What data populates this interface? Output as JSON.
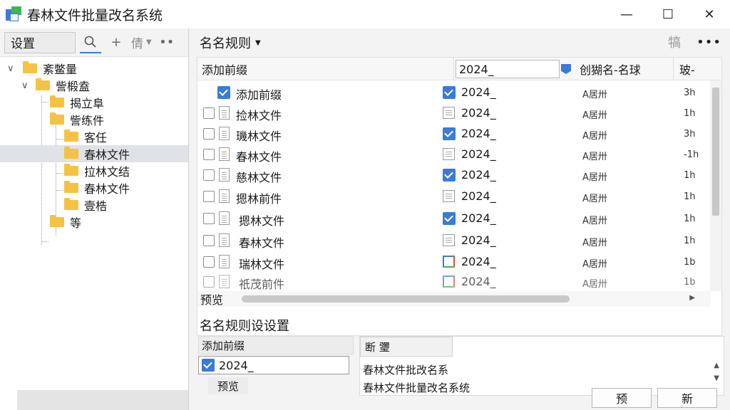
{
  "window": {
    "title": "春林文件批量改名系统",
    "controls": {
      "minimize": "—",
      "maximize": "☐",
      "close": "✕"
    }
  },
  "left_toolbar": {
    "settings_label": "设置",
    "search_icon": "search-icon",
    "add_symbol": "+",
    "combo_label": "倩",
    "more_symbol": "••"
  },
  "tree": {
    "items": [
      {
        "label": "紊鳖量"
      },
      {
        "label": "訾椴盍"
      },
      {
        "label": "揭立阜"
      },
      {
        "label": "訾练件"
      },
      {
        "label": "客任"
      },
      {
        "label": "春林文件"
      },
      {
        "label": "拉林文结"
      },
      {
        "label": "春林文件"
      },
      {
        "label": "壹梏"
      },
      {
        "label": "等"
      }
    ]
  },
  "right_header": {
    "title": "名名规则",
    "icon_label": "犒",
    "more_symbol": "•••"
  },
  "grid": {
    "columns": [
      "添加前缀",
      "创猢名-名球",
      "玻-"
    ],
    "prefix_value": "2024_",
    "rows": [
      {
        "name": "添加前缀",
        "value": "2024_",
        "date": "A居卅",
        "size": "3h"
      },
      {
        "name": "捡林文件",
        "value": "2024_",
        "date": "A居卅",
        "size": "1h"
      },
      {
        "name": "璣林文件",
        "value": "2024_",
        "date": "A居卅",
        "size": "3h"
      },
      {
        "name": "春林文件",
        "value": "2024_",
        "date": "A居卅",
        "size": "-1h"
      },
      {
        "name": "慈林文件",
        "value": "2024_",
        "date": "A居卅",
        "size": "1h"
      },
      {
        "name": "摁林前件",
        "value": "2024_",
        "date": "A居卅",
        "size": "1h"
      },
      {
        "name": "摁林文件",
        "value": "2024_",
        "date": "A居卅",
        "size": "1h"
      },
      {
        "name": "春林文件",
        "value": "2024_",
        "date": "A居卅",
        "size": "1h"
      },
      {
        "name": "瑞林文件",
        "value": "2024_",
        "date": "A居卅",
        "size": "1b"
      },
      {
        "name": "祇茂前件",
        "value": "2024_",
        "date": "A居卅",
        "size": "1b"
      }
    ],
    "preview_label": "预览"
  },
  "rules": {
    "title": "名名规则设设置",
    "left_label": "添加前缀",
    "left_input": "2024_",
    "left_preview": "预览",
    "right_tab": "断 瓕",
    "right_line1": "春林文件批改名系",
    "right_line2": "春林文件批量改名系统"
  },
  "buttons": {
    "preview": "预",
    "new": "新"
  }
}
